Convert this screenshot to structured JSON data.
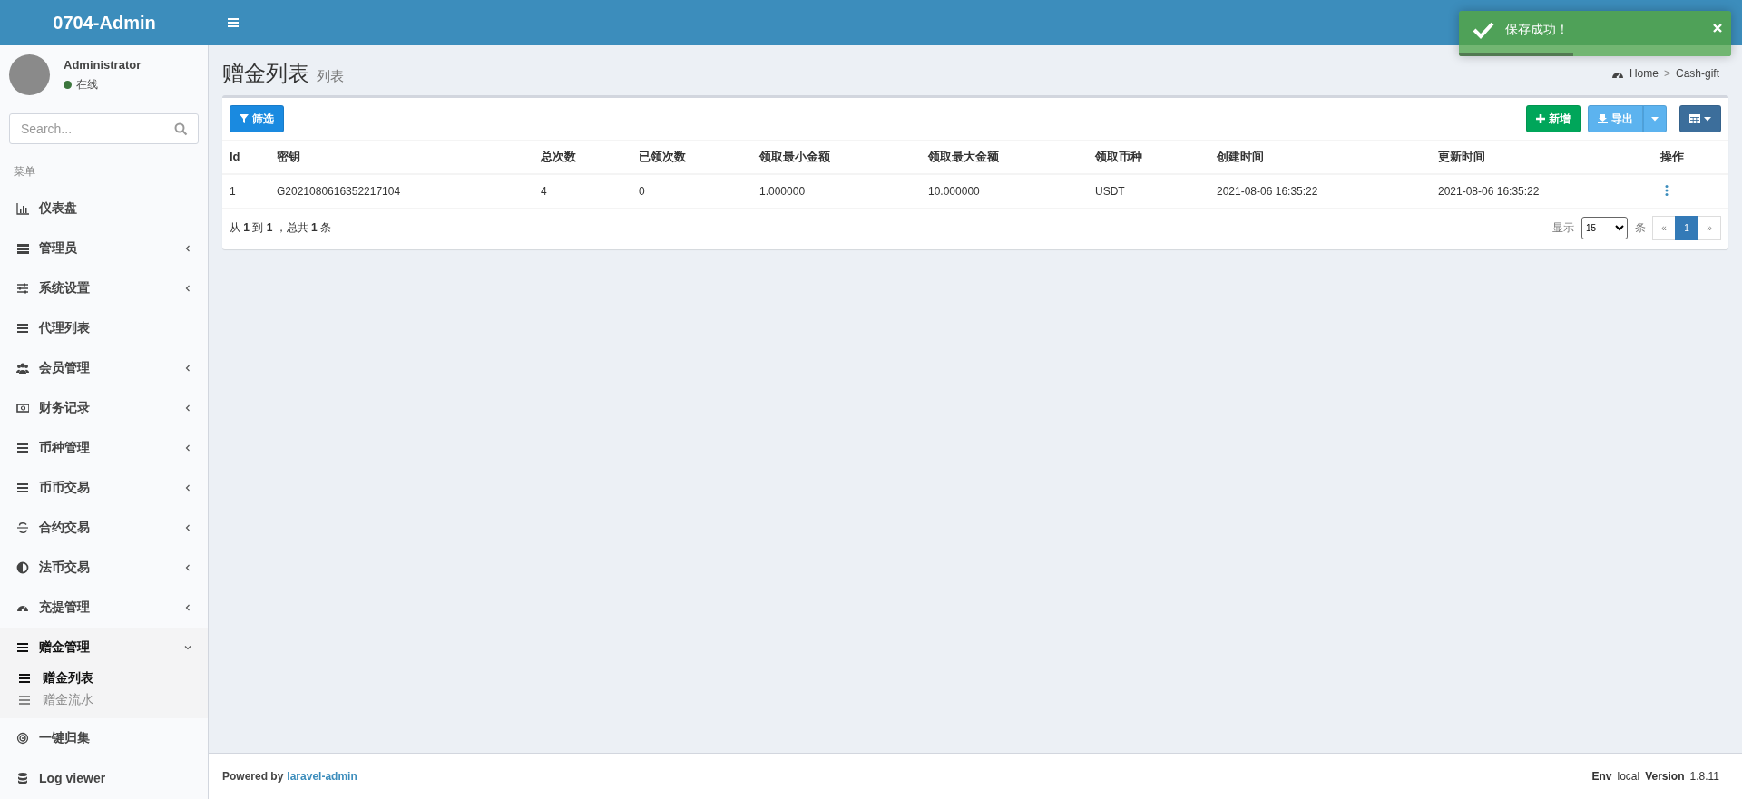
{
  "header": {
    "brand": "0704-Admin"
  },
  "toast": {
    "message": "保存成功！",
    "level": 0.42
  },
  "sidebar": {
    "user": {
      "name": "Administrator",
      "status": "在线"
    },
    "search": {
      "placeholder": "Search..."
    },
    "menu_header": "菜单",
    "items": [
      {
        "label": "仪表盘"
      },
      {
        "label": "管理员",
        "expanded": false
      },
      {
        "label": "系统设置",
        "expanded": false
      },
      {
        "label": "代理列表"
      },
      {
        "label": "会员管理",
        "expanded": false
      },
      {
        "label": "财务记录",
        "expanded": false
      },
      {
        "label": "币种管理",
        "expanded": false
      },
      {
        "label": "币币交易",
        "expanded": false
      },
      {
        "label": "合约交易",
        "expanded": false
      },
      {
        "label": "法币交易",
        "expanded": false
      },
      {
        "label": "充提管理",
        "expanded": false
      },
      {
        "label": "赠金管理",
        "expanded": true,
        "children": [
          {
            "label": "赠金列表",
            "selected": true
          },
          {
            "label": "赠金流水",
            "selected": false
          }
        ]
      },
      {
        "label": "一键归集"
      },
      {
        "label": "Log viewer"
      }
    ]
  },
  "page": {
    "title": "赠金列表",
    "subtitle": "列表",
    "breadcrumb": [
      "Home",
      "Cash-gift"
    ],
    "breadcrumb_separator": ">"
  },
  "toolbar": {
    "filter_button": "筛选",
    "create_button": "新增",
    "export_button": "导出"
  },
  "table": {
    "columns": [
      "Id",
      "密钥",
      "总次数",
      "已领次数",
      "领取最小金额",
      "领取最大金额",
      "领取币种",
      "创建时间",
      "更新时间",
      "操作"
    ],
    "rows": [
      [
        "1",
        "G2021080616352217104",
        "4",
        "0",
        "1.000000",
        "10.000000",
        "USDT",
        "2021-08-06 16:35:22",
        "2021-08-06 16:35:22"
      ]
    ]
  },
  "pagination": {
    "summary": "从 **1** 到 **1** ，总共 **1** 条",
    "per_page_label": "显示",
    "per_page": "15",
    "per_page_unit": "条",
    "pages": [
      {
        "label": "«",
        "selected": false
      },
      {
        "label": "1",
        "selected": true
      },
      {
        "label": "»",
        "selected": false
      }
    ]
  },
  "footer": {
    "powered_by": "Powered by",
    "link": "laravel-admin",
    "env_label": "Env",
    "env": "local",
    "version_label": "Version",
    "version": "1.8.11"
  }
}
